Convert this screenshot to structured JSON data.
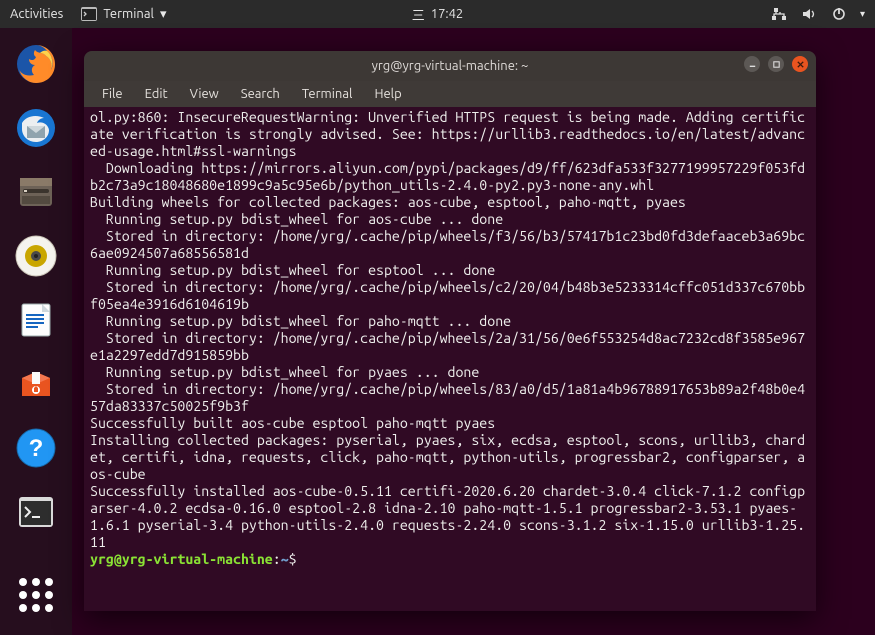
{
  "topbar": {
    "activities": "Activities",
    "app_label": "Terminal",
    "clock": "17:42"
  },
  "dock": {
    "items": [
      "firefox",
      "thunderbird",
      "files",
      "rhythmbox",
      "writer",
      "software",
      "help",
      "terminal"
    ]
  },
  "window": {
    "title": "yrg@yrg-virtual-machine: ~"
  },
  "menubar": {
    "file": "File",
    "edit": "Edit",
    "view": "View",
    "search": "Search",
    "terminal": "Terminal",
    "help": "Help"
  },
  "terminal": {
    "lines": "ol.py:860: InsecureRequestWarning: Unverified HTTPS request is being made. Adding certificate verification is strongly advised. See: https://urllib3.readthedocs.io/en/latest/advanced-usage.html#ssl-warnings\n  Downloading https://mirrors.aliyun.com/pypi/packages/d9/ff/623dfa533f3277199957229f053fdb2c73a9c18048680e1899c9a5c95e6b/python_utils-2.4.0-py2.py3-none-any.whl\nBuilding wheels for collected packages: aos-cube, esptool, paho-mqtt, pyaes\n  Running setup.py bdist_wheel for aos-cube ... done\n  Stored in directory: /home/yrg/.cache/pip/wheels/f3/56/b3/57417b1c23bd0fd3defaaceb3a69bc6ae0924507a68556581d\n  Running setup.py bdist_wheel for esptool ... done\n  Stored in directory: /home/yrg/.cache/pip/wheels/c2/20/04/b48b3e5233314cffc051d337c670bbf05ea4e3916d6104619b\n  Running setup.py bdist_wheel for paho-mqtt ... done\n  Stored in directory: /home/yrg/.cache/pip/wheels/2a/31/56/0e6f553254d8ac7232cd8f3585e967e1a2297edd7d915859bb\n  Running setup.py bdist_wheel for pyaes ... done\n  Stored in directory: /home/yrg/.cache/pip/wheels/83/a0/d5/1a81a4b96788917653b89a2f48b0e457da83337c50025f9b3f\nSuccessfully built aos-cube esptool paho-mqtt pyaes\nInstalling collected packages: pyserial, pyaes, six, ecdsa, esptool, scons, urllib3, chardet, certifi, idna, requests, click, paho-mqtt, python-utils, progressbar2, configparser, aos-cube\nSuccessfully installed aos-cube-0.5.11 certifi-2020.6.20 chardet-3.0.4 click-7.1.2 configparser-4.0.2 ecdsa-0.16.0 esptool-2.8 idna-2.10 paho-mqtt-1.5.1 progressbar2-3.53.1 pyaes-1.6.1 pyserial-3.4 python-utils-2.4.0 requests-2.24.0 scons-3.1.2 six-1.15.0 urllib3-1.25.11",
    "prompt_user": "yrg@yrg-virtual-machine",
    "prompt_sep": ":",
    "prompt_path": "~",
    "prompt_end": "$"
  }
}
